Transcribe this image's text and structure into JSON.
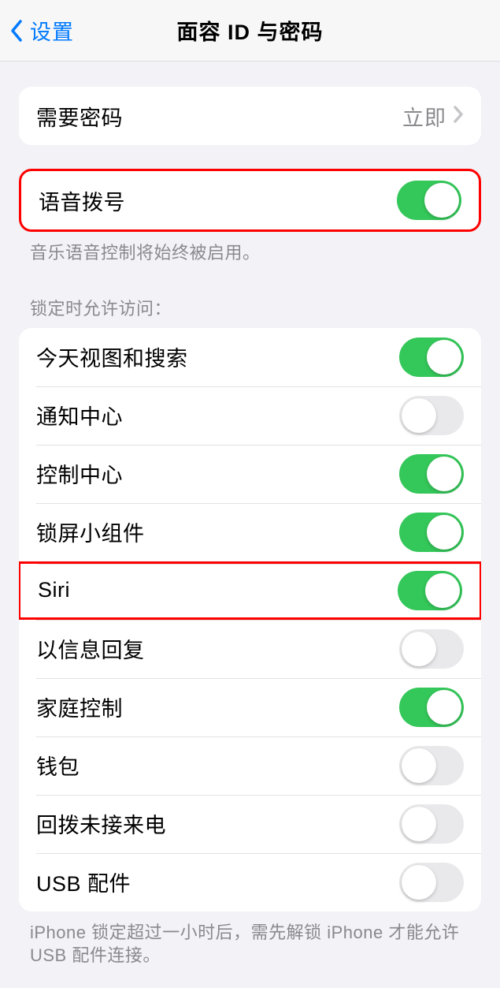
{
  "nav": {
    "back_label": "设置",
    "title": "面容 ID 与密码"
  },
  "group1": {
    "require_passcode": {
      "label": "需要密码",
      "value": "立即"
    }
  },
  "group2": {
    "voice_dial": {
      "label": "语音拨号"
    },
    "footer": "音乐语音控制将始终被启用。"
  },
  "group3": {
    "header": "锁定时允许访问：",
    "items": {
      "today_view": {
        "label": "今天视图和搜索"
      },
      "notification_center": {
        "label": "通知中心"
      },
      "control_center": {
        "label": "控制中心"
      },
      "lock_widgets": {
        "label": "锁屏小组件"
      },
      "siri": {
        "label": "Siri"
      },
      "reply_message": {
        "label": "以信息回复"
      },
      "home_control": {
        "label": "家庭控制"
      },
      "wallet": {
        "label": "钱包"
      },
      "return_calls": {
        "label": "回拨未接来电"
      },
      "usb_accessories": {
        "label": "USB 配件"
      }
    },
    "footer": "iPhone 锁定超过一小时后，需先解锁 iPhone 才能允许 USB 配件连接。"
  }
}
